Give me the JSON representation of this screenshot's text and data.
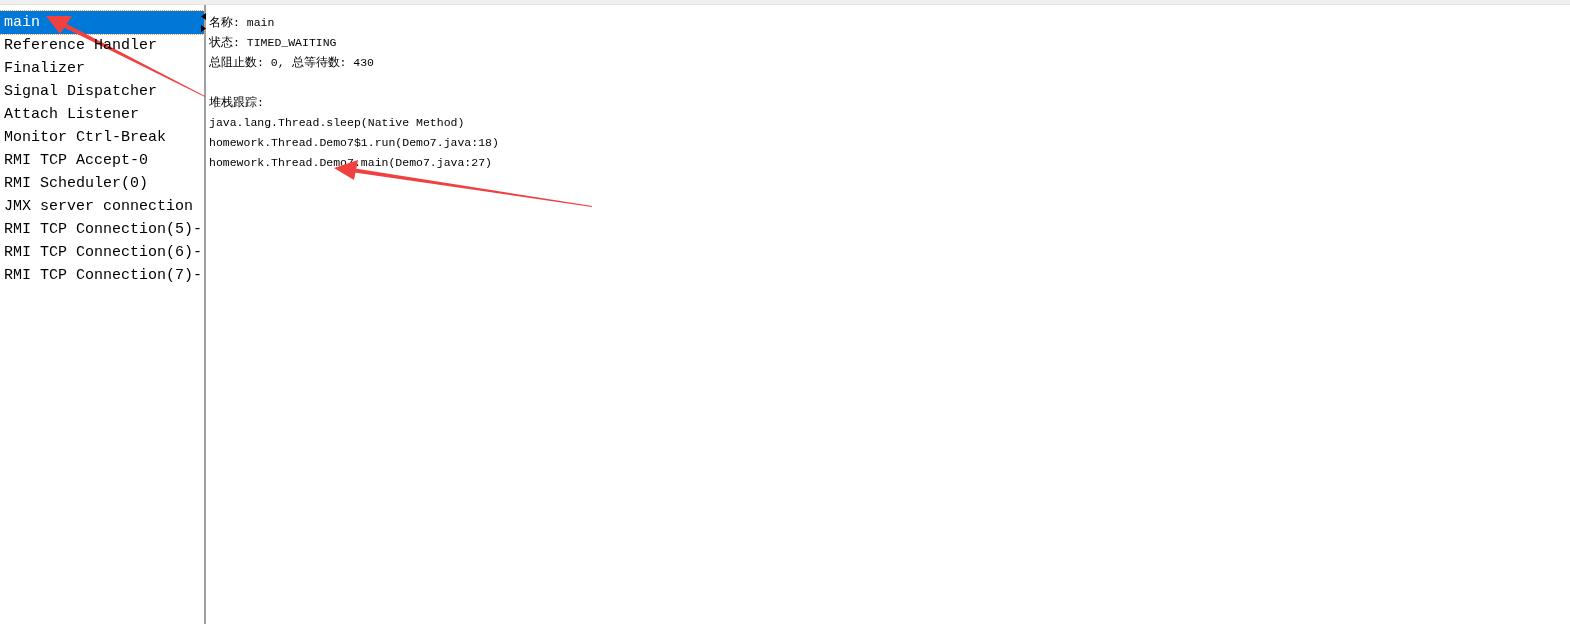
{
  "threads": [
    {
      "label": "main",
      "selected": true
    },
    {
      "label": "Reference Handler",
      "selected": false
    },
    {
      "label": "Finalizer",
      "selected": false
    },
    {
      "label": "Signal Dispatcher",
      "selected": false
    },
    {
      "label": "Attach Listener",
      "selected": false
    },
    {
      "label": "Monitor Ctrl-Break",
      "selected": false
    },
    {
      "label": "RMI TCP Accept-0",
      "selected": false
    },
    {
      "label": "RMI Scheduler(0)",
      "selected": false
    },
    {
      "label": "JMX server connection",
      "selected": false
    },
    {
      "label": "RMI TCP Connection(5)-",
      "selected": false
    },
    {
      "label": "RMI TCP Connection(6)-",
      "selected": false
    },
    {
      "label": "RMI TCP Connection(7)-",
      "selected": false
    }
  ],
  "details": {
    "lines": [
      "名称: main",
      "状态: TIMED_WAITING",
      "总阻止数: 0, 总等待数: 430"
    ],
    "stack_heading": "堆栈跟踪:",
    "stack_trace": [
      "java.lang.Thread.sleep(Native Method)",
      "homework.Thread.Demo7$1.run(Demo7.java:18)",
      "homework.Thread.Demo7.main(Demo7.java:27)"
    ]
  }
}
